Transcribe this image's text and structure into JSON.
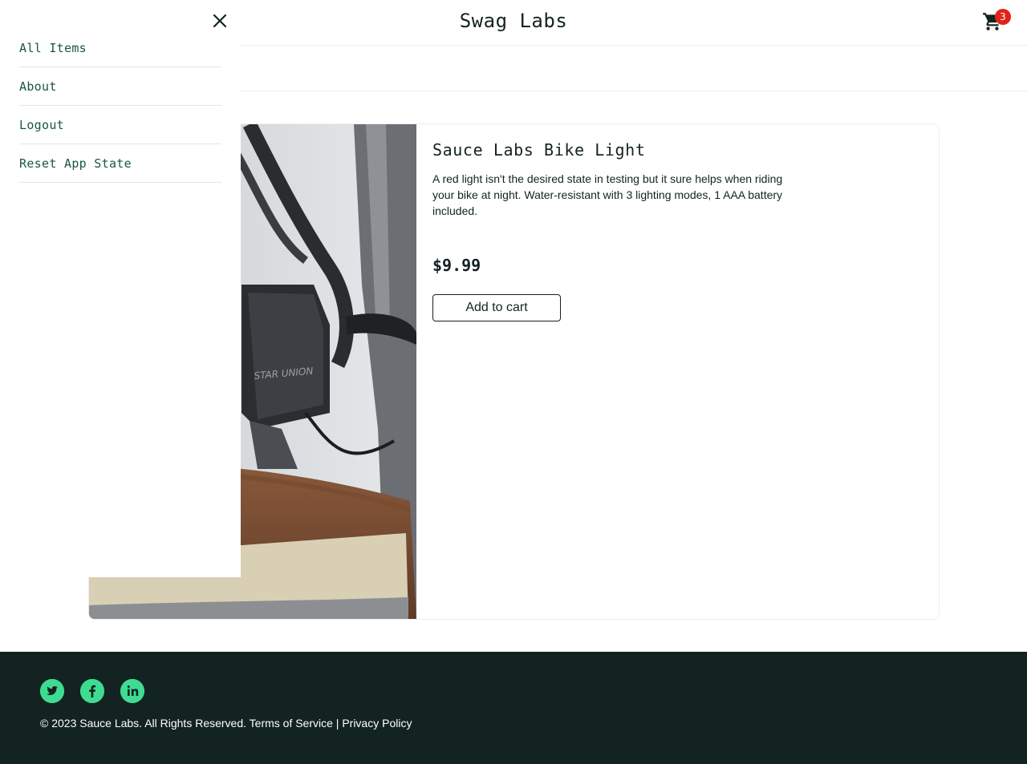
{
  "header": {
    "app_title": "Swag Labs",
    "cart_count": "3",
    "cart_icon": "shopping-cart-icon"
  },
  "menu": {
    "close_icon": "close-icon",
    "items": [
      {
        "label": "All Items"
      },
      {
        "label": "About"
      },
      {
        "label": "Logout"
      },
      {
        "label": "Reset App State"
      }
    ]
  },
  "product": {
    "name": "Sauce Labs Bike Light",
    "description": "A red light isn't the desired state in testing but it sure helps when riding your bike at night. Water-resistant with 3 lighting modes, 1 AAA battery included.",
    "price": "$9.99",
    "add_button": "Add to cart",
    "image_brand_text": "STAR UNION"
  },
  "footer": {
    "social": [
      "twitter-icon",
      "facebook-icon",
      "linkedin-icon"
    ],
    "copyright": "© 2023 Sauce Labs. All Rights Reserved. Terms of Service | Privacy Policy"
  },
  "colors": {
    "dark": "#132322",
    "accent_green": "#3ddc91",
    "badge_red": "#e2231a",
    "menu_text": "#18583a"
  }
}
